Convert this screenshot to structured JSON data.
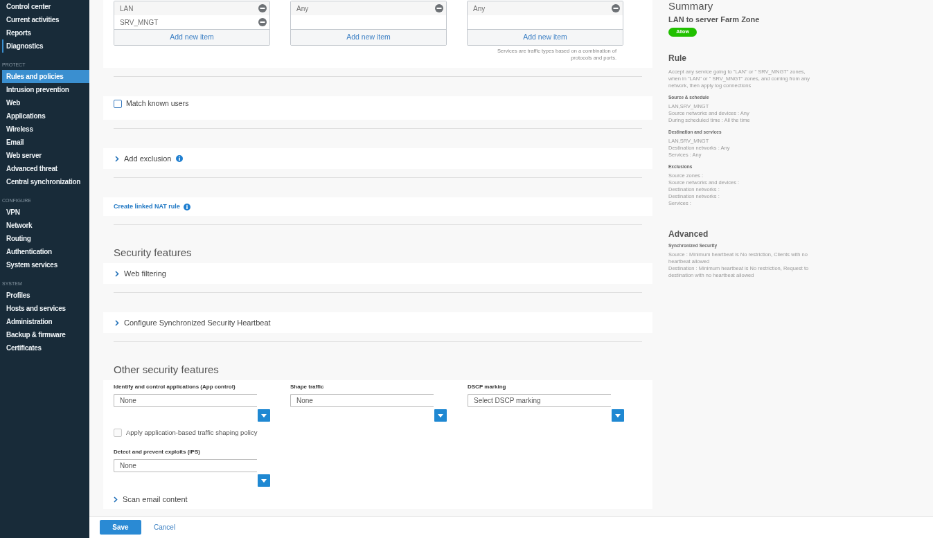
{
  "sidebar": {
    "sections": [
      {
        "items": [
          {
            "label": "Control center",
            "selected": false,
            "focused": false
          },
          {
            "label": "Current activities",
            "selected": false,
            "focused": false
          },
          {
            "label": "Reports",
            "selected": false,
            "focused": false
          },
          {
            "label": "Diagnostics",
            "selected": false,
            "focused": true
          }
        ]
      },
      {
        "heading": "PROTECT",
        "items": [
          {
            "label": "Rules and policies",
            "selected": true,
            "focused": false
          },
          {
            "label": "Intrusion prevention",
            "selected": false,
            "focused": false
          },
          {
            "label": "Web",
            "selected": false,
            "focused": false
          },
          {
            "label": "Applications",
            "selected": false,
            "focused": false
          },
          {
            "label": "Wireless",
            "selected": false,
            "focused": false
          },
          {
            "label": "Email",
            "selected": false,
            "focused": false
          },
          {
            "label": "Web server",
            "selected": false,
            "focused": false
          },
          {
            "label": "Advanced threat",
            "selected": false,
            "focused": false
          },
          {
            "label": "Central synchronization",
            "selected": false,
            "focused": false
          }
        ]
      },
      {
        "heading": "CONFIGURE",
        "items": [
          {
            "label": "VPN",
            "selected": false,
            "focused": false
          },
          {
            "label": "Network",
            "selected": false,
            "focused": false
          },
          {
            "label": "Routing",
            "selected": false,
            "focused": false
          },
          {
            "label": "Authentication",
            "selected": false,
            "focused": false
          },
          {
            "label": "System services",
            "selected": false,
            "focused": false
          }
        ]
      },
      {
        "heading": "SYSTEM",
        "items": [
          {
            "label": "Profiles",
            "selected": false,
            "focused": false
          },
          {
            "label": "Hosts and services",
            "selected": false,
            "focused": false
          },
          {
            "label": "Administration",
            "selected": false,
            "focused": false
          },
          {
            "label": "Backup & firmware",
            "selected": false,
            "focused": false
          },
          {
            "label": "Certificates",
            "selected": false,
            "focused": false
          }
        ]
      }
    ]
  },
  "form": {
    "sections": [
      {
        "kind": "item_lists",
        "lists": [
          {
            "items": [
              {
                "label": "LAN"
              },
              {
                "label": "SRV_MNGT"
              }
            ],
            "add_label": "Add new item"
          },
          {
            "items": [
              {
                "label": "Any"
              }
            ],
            "add_label": "Add new item"
          },
          {
            "items": [
              {
                "label": "Any"
              }
            ],
            "add_label": "Add new item",
            "note": "Services are traffic types based on a combination of protocols and ports."
          }
        ]
      },
      {
        "kind": "checkbox",
        "label": "Match known users",
        "checked": false,
        "disabled": false
      },
      {
        "kind": "expander",
        "label": "Add exclusion",
        "expanded": false,
        "info": true
      },
      {
        "kind": "link",
        "label": "Create linked NAT rule",
        "info": true
      },
      {
        "kind": "heading",
        "text": "Security features"
      },
      {
        "kind": "expander",
        "label": "Web filtering",
        "expanded": false,
        "info": false
      },
      {
        "kind": "expander",
        "label": "Configure Synchronized Security Heartbeat",
        "expanded": false,
        "info": false
      },
      {
        "kind": "heading",
        "text": "Other security features"
      },
      {
        "kind": "fields",
        "columns": [
          {
            "items": [
              {
                "kind": "select",
                "label": "Identify and control applications (App control)",
                "value": "None"
              },
              {
                "kind": "checkbox",
                "label": "Apply application-based traffic shaping policy",
                "checked": false,
                "disabled": true
              },
              {
                "kind": "select",
                "label": "Detect and prevent exploits (IPS)",
                "value": "None"
              }
            ]
          },
          {
            "items": [
              {
                "kind": "select",
                "label": "Shape traffic",
                "value": "None"
              }
            ]
          },
          {
            "items": [
              {
                "kind": "select",
                "label": "DSCP marking",
                "value": "Select DSCP marking"
              }
            ]
          }
        ],
        "expanders": [
          {
            "label": "Scan email content",
            "expanded": false
          }
        ]
      }
    ]
  },
  "summary": {
    "title": "Summary",
    "rule_name": "LAN to server Farm Zone",
    "action": "Allow",
    "sections": [
      {
        "heading": "Rule",
        "text": "Accept any service going to \"LAN\" or \" SRV_MNGT\" zones, when in \"LAN\" or \" SRV_MNGT\" zones, and coming from any network, then apply log connections",
        "groups": [
          {
            "heading": "Source & schedule",
            "lines": [
              "LAN,SRV_MNGT",
              "Source networks and devices : Any",
              "During scheduled time : All the time"
            ]
          },
          {
            "heading": "Destination and services",
            "lines": [
              "LAN,SRV_MNGT",
              "Destination networks : Any",
              "Services : Any"
            ]
          },
          {
            "heading": "Exclusions",
            "lines": [
              "Source zones :",
              "Source networks and devices :",
              "Destination networks :",
              "Destination networks :",
              "Services :"
            ]
          }
        ]
      },
      {
        "heading": "Advanced",
        "groups": [
          {
            "heading": "Synchronized Security",
            "lines": [
              "Source : Minimum heartbeat is No restriction, Clients with no heartbeat allowed",
              "Destination : Minimum heartbeat is No restriction, Request to destination with no heartbeat allowed"
            ]
          }
        ]
      }
    ]
  },
  "footer": {
    "buttons": [
      {
        "label": "Save",
        "kind": "primary"
      },
      {
        "label": "Cancel",
        "kind": "link"
      }
    ]
  }
}
